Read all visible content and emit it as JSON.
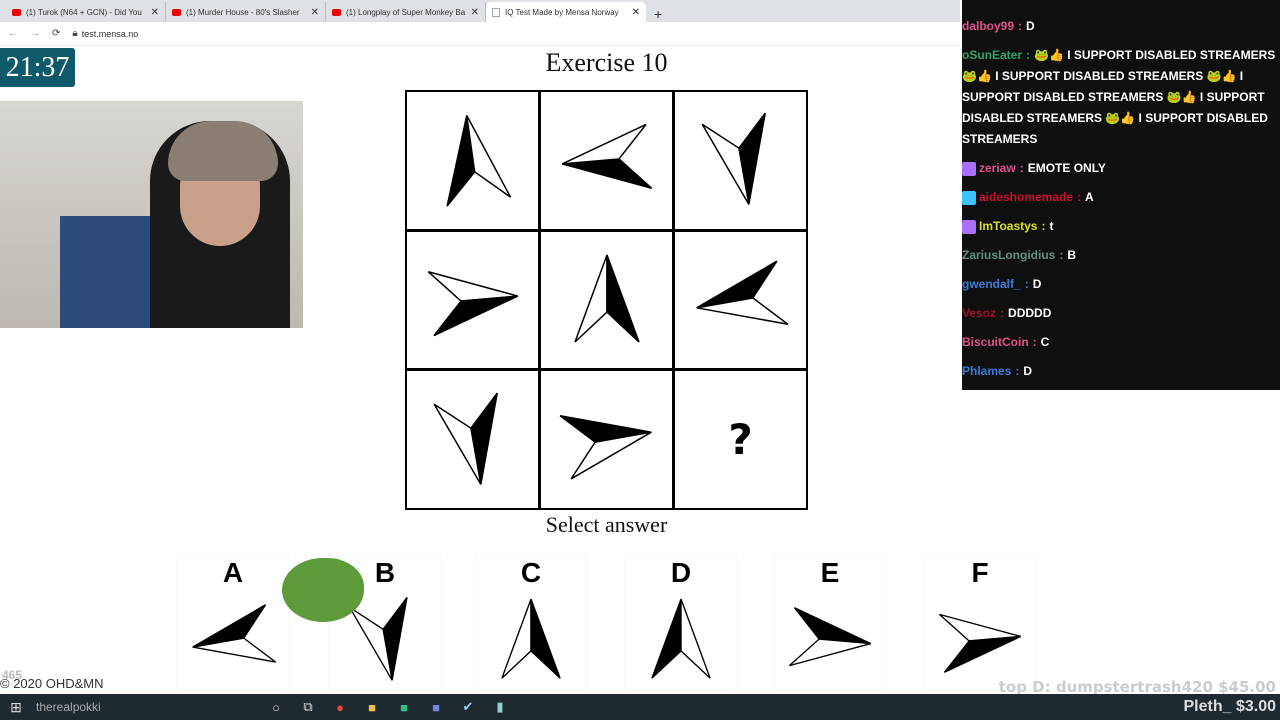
{
  "browser": {
    "tabs": [
      {
        "title": "(1) Turok (N64 + GCN) - Did You",
        "icon": "youtube-icon"
      },
      {
        "title": "(1) Murder House - 80's Slasher",
        "icon": "youtube-icon"
      },
      {
        "title": "(1) Longplay of Super Monkey Ba",
        "icon": "youtube-icon"
      },
      {
        "title": "IQ Test Made by Mensa Norway",
        "icon": "page-icon",
        "active": true
      }
    ],
    "new_tab": "+",
    "url": "test.mensa.no"
  },
  "timer": "21:37",
  "exercise": {
    "title": "Exercise 10",
    "cells": [
      {
        "dir": -8,
        "black": "left"
      },
      {
        "dir": -95,
        "black": "left"
      },
      {
        "dir": 170,
        "black": "left"
      },
      {
        "dir": 85,
        "black": "right"
      },
      {
        "dir": 0,
        "black": "right"
      },
      {
        "dir": -100,
        "black": "right"
      },
      {
        "dir": 170,
        "black": "left"
      },
      {
        "dir": 80,
        "black": "left"
      },
      {
        "question": "?"
      }
    ],
    "select_label": "Select answer",
    "answers": [
      {
        "label": "A",
        "dir": -100,
        "black": "right"
      },
      {
        "label": "B",
        "dir": 170,
        "black": "left"
      },
      {
        "label": "C",
        "dir": 0,
        "black": "right"
      },
      {
        "label": "D",
        "dir": 0,
        "black": "left"
      },
      {
        "label": "E",
        "dir": 95,
        "black": "left"
      },
      {
        "label": "F",
        "dir": 85,
        "black": "right"
      }
    ],
    "copyright": "© 2020 OHD&MN"
  },
  "chat": [
    {
      "user": "dalboy99",
      "text": "D",
      "color": "#e0508a"
    },
    {
      "user": "oSunEater",
      "text": "🐸👍 I SUPPORT DISABLED STREAMERS 🐸👍 I SUPPORT DISABLED STREAMERS 🐸👍 I SUPPORT DISABLED STREAMERS 🐸👍 I SUPPORT DISABLED STREAMERS 🐸👍 I SUPPORT DISABLED STREAMERS",
      "color": "#2fa36b"
    },
    {
      "user": "zeriaw",
      "text": "EMOTE ONLY",
      "color": "#e0508a",
      "badge": "#a970ff"
    },
    {
      "user": "aideshomemade",
      "text": "A",
      "color": "#c8102e",
      "badge": "#3ec1ff"
    },
    {
      "user": "ImToastys",
      "text": "t",
      "color": "#d8e020",
      "badge": "#a970ff"
    },
    {
      "user": "ZariusLongidius",
      "text": "B",
      "color": "#5f8f80"
    },
    {
      "user": "gwendalf_",
      "text": "D",
      "color": "#3a7bd5"
    },
    {
      "user": "Vesoz",
      "text": "DDDDD",
      "color": "#a0102a"
    },
    {
      "user": "BiscuitCoin",
      "text": "C",
      "color": "#e0508a"
    },
    {
      "user": "Phlames",
      "text": "D",
      "color": "#3a7bd5"
    }
  ],
  "stream_overlay": {
    "top_donation": "top D: dumpstertrash420 $45.00",
    "latest": "Pleth_ $3.00",
    "counter": "465",
    "channel": "therealpokki"
  }
}
